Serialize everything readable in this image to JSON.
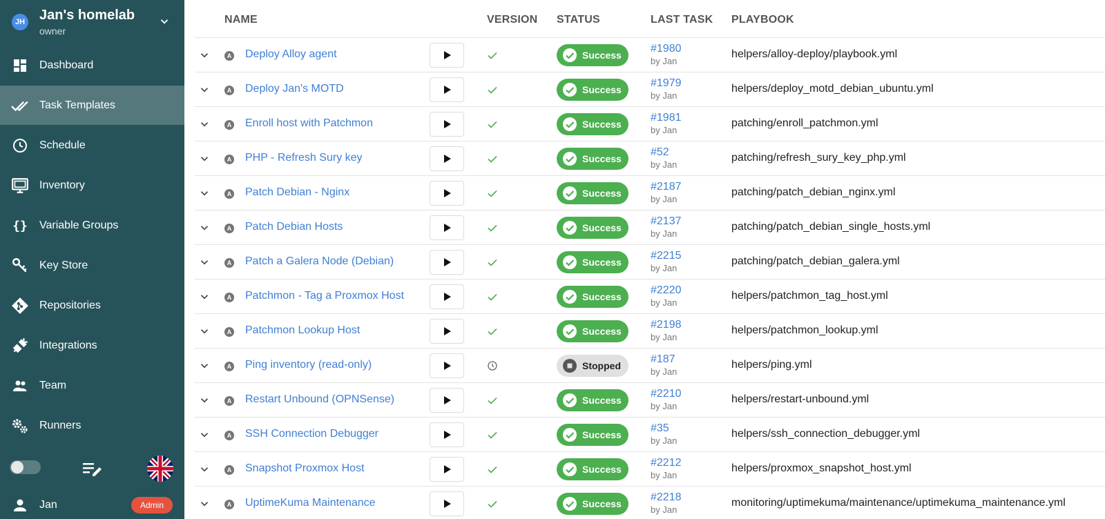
{
  "project": {
    "initials": "JH",
    "name": "Jan's homelab",
    "role": "owner"
  },
  "nav": [
    {
      "label": "Dashboard",
      "icon": "dashboard-icon",
      "active": false
    },
    {
      "label": "Task Templates",
      "icon": "task-templates-icon",
      "active": true
    },
    {
      "label": "Schedule",
      "icon": "clock-icon",
      "active": false
    },
    {
      "label": "Inventory",
      "icon": "monitor-icon",
      "active": false
    },
    {
      "label": "Variable Groups",
      "icon": "braces-icon",
      "active": false
    },
    {
      "label": "Key Store",
      "icon": "key-icon",
      "active": false
    },
    {
      "label": "Repositories",
      "icon": "git-icon",
      "active": false
    },
    {
      "label": "Integrations",
      "icon": "plug-icon",
      "active": false
    },
    {
      "label": "Team",
      "icon": "team-icon",
      "active": false
    },
    {
      "label": "Runners",
      "icon": "gears-icon",
      "active": false
    }
  ],
  "user": {
    "name": "Jan",
    "badge": "Admin"
  },
  "table": {
    "columns": {
      "name": "NAME",
      "version": "VERSION",
      "status": "STATUS",
      "last_task": "LAST TASK",
      "playbook": "PLAYBOOK"
    },
    "rows": [
      {
        "name": "Deploy Alloy agent",
        "version": "check",
        "status": "Success",
        "task": "#1980",
        "by": "by Jan",
        "playbook": "helpers/alloy-deploy/playbook.yml"
      },
      {
        "name": "Deploy Jan's MOTD",
        "version": "check",
        "status": "Success",
        "task": "#1979",
        "by": "by Jan",
        "playbook": "helpers/deploy_motd_debian_ubuntu.yml"
      },
      {
        "name": "Enroll host with Patchmon",
        "version": "check",
        "status": "Success",
        "task": "#1981",
        "by": "by Jan",
        "playbook": "patching/enroll_patchmon.yml"
      },
      {
        "name": "PHP - Refresh Sury key",
        "version": "check",
        "status": "Success",
        "task": "#52",
        "by": "by Jan",
        "playbook": "patching/refresh_sury_key_php.yml"
      },
      {
        "name": "Patch Debian - Nginx",
        "version": "check",
        "status": "Success",
        "task": "#2187",
        "by": "by Jan",
        "playbook": "patching/patch_debian_nginx.yml"
      },
      {
        "name": "Patch Debian Hosts",
        "version": "check",
        "status": "Success",
        "task": "#2137",
        "by": "by Jan",
        "playbook": "patching/patch_debian_single_hosts.yml"
      },
      {
        "name": "Patch a Galera Node (Debian)",
        "version": "check",
        "status": "Success",
        "task": "#2215",
        "by": "by Jan",
        "playbook": "patching/patch_debian_galera.yml"
      },
      {
        "name": "Patchmon - Tag a Proxmox Host",
        "version": "check",
        "status": "Success",
        "task": "#2220",
        "by": "by Jan",
        "playbook": "helpers/patchmon_tag_host.yml"
      },
      {
        "name": "Patchmon Lookup Host",
        "version": "check",
        "status": "Success",
        "task": "#2198",
        "by": "by Jan",
        "playbook": "helpers/patchmon_lookup.yml"
      },
      {
        "name": "Ping inventory (read-only)",
        "version": "clock",
        "status": "Stopped",
        "task": "#187",
        "by": "by Jan",
        "playbook": "helpers/ping.yml"
      },
      {
        "name": "Restart Unbound (OPNSense)",
        "version": "check",
        "status": "Success",
        "task": "#2210",
        "by": "by Jan",
        "playbook": "helpers/restart-unbound.yml"
      },
      {
        "name": "SSH Connection Debugger",
        "version": "check",
        "status": "Success",
        "task": "#35",
        "by": "by Jan",
        "playbook": "helpers/ssh_connection_debugger.yml"
      },
      {
        "name": "Snapshot Proxmox Host",
        "version": "check",
        "status": "Success",
        "task": "#2212",
        "by": "by Jan",
        "playbook": "helpers/proxmox_snapshot_host.yml"
      },
      {
        "name": "UptimeKuma Maintenance",
        "version": "check",
        "status": "Success",
        "task": "#2218",
        "by": "by Jan",
        "playbook": "monitoring/uptimekuma/maintenance/uptimekuma_maintenance.yml"
      }
    ]
  },
  "colors": {
    "sidebar": "#265359",
    "link": "#3f7fd4",
    "success": "#4caf50",
    "badge": "#e5533e"
  }
}
